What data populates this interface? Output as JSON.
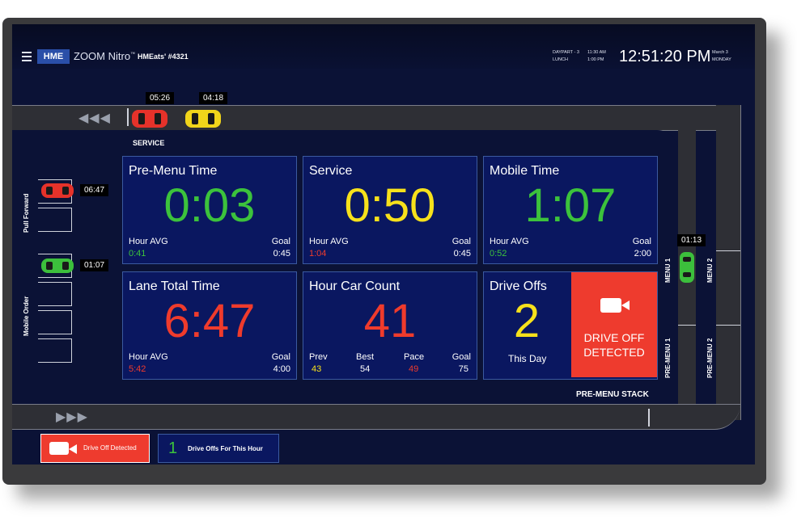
{
  "header": {
    "brand": "HME",
    "product": "ZOOM Nitro",
    "product_tm": "™",
    "store": "HMEats' #4321",
    "daypart_line1": "DAYPART - 3",
    "daypart_line2": "LUNCH",
    "time_range_line1": "11:30 AM",
    "time_range_line2": "1:00 PM",
    "clock": "12:51:20 PM",
    "date_line1": "March 3",
    "date_line2": "MONDAY"
  },
  "lanes": {
    "service_label": "SERVICE",
    "pull_forward_label": "Pull Forward",
    "mobile_order_label": "Mobile Order",
    "menu1_label": "MENU 1",
    "menu2_label": "MENU 2",
    "premenu1_label": "PRE-MENU 1",
    "premenu2_label": "PRE-MENU 2",
    "premenu_stack_label": "PRE-MENU STACK",
    "arrows_top": "◀◀◀",
    "arrows_bottom": "▶▶▶"
  },
  "cars": [
    {
      "id": "service-red",
      "timer": "05:26",
      "color": "#e5322a"
    },
    {
      "id": "service-yellow",
      "timer": "04:18",
      "color": "#f1d51a"
    },
    {
      "id": "pull-forward-red",
      "timer": "06:47",
      "color": "#e5322a"
    },
    {
      "id": "mobile-green",
      "timer": "01:07",
      "color": "#3cbf3c"
    },
    {
      "id": "menu-green",
      "timer": "01:13",
      "color": "#3cbf3c"
    }
  ],
  "tiles": {
    "premenu": {
      "title": "Pre-Menu Time",
      "value": "0:03",
      "avg_label": "Hour AVG",
      "avg": "0:41",
      "goal_label": "Goal",
      "goal": "0:45"
    },
    "service": {
      "title": "Service",
      "value": "0:50",
      "avg_label": "Hour AVG",
      "avg": "1:04",
      "goal_label": "Goal",
      "goal": "0:45"
    },
    "mobile": {
      "title": "Mobile Time",
      "value": "1:07",
      "avg_label": "Hour AVG",
      "avg": "0:52",
      "goal_label": "Goal",
      "goal": "2:00"
    },
    "lane_total": {
      "title": "Lane Total Time",
      "value": "6:47",
      "avg_label": "Hour AVG",
      "avg": "5:42",
      "goal_label": "Goal",
      "goal": "4:00"
    },
    "car_count": {
      "title": "Hour Car Count",
      "value": "41",
      "prev_label": "Prev",
      "prev": "43",
      "best_label": "Best",
      "best": "54",
      "pace_label": "Pace",
      "pace": "49",
      "goal_label": "Goal",
      "goal": "75"
    },
    "drive_offs": {
      "title": "Drive Offs",
      "value": "2",
      "sub": "This Day"
    }
  },
  "alert": {
    "line1": "DRIVE OFF",
    "line2": "DETECTED"
  },
  "footer": {
    "tab1_label": "Drive Off Detected",
    "tab2_count": "1",
    "tab2_label": "Drive Offs For This Hour"
  },
  "colors": {
    "green": "#3cc23c",
    "yellow": "#f7e11b",
    "red": "#ef3b2c",
    "tile_bg": "#0a1760",
    "screen_bg": "#0b1236"
  }
}
